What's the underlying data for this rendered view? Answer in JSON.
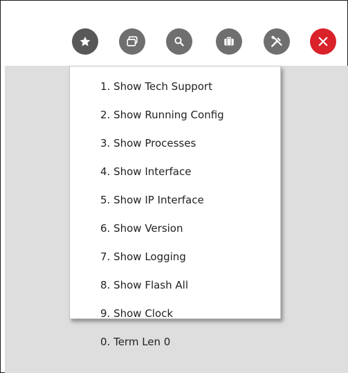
{
  "toolbar": {
    "buttons": [
      {
        "icon": "star-icon",
        "color": "#585858"
      },
      {
        "icon": "windows-icon",
        "color": "#6f6f6f"
      },
      {
        "icon": "search-icon",
        "color": "#6f6f6f"
      },
      {
        "icon": "briefcase-icon",
        "color": "#6f6f6f"
      },
      {
        "icon": "tools-icon",
        "color": "#6f6f6f"
      },
      {
        "icon": "close-icon",
        "color": "#d9222a"
      }
    ]
  },
  "menu": {
    "items": [
      {
        "label": "1. Show Tech Support"
      },
      {
        "label": "2. Show Running Config"
      },
      {
        "label": "3. Show Processes"
      },
      {
        "label": "4. Show Interface"
      },
      {
        "label": "5. Show IP Interface"
      },
      {
        "label": "6. Show Version"
      },
      {
        "label": "7. Show Logging"
      },
      {
        "label": "8. Show Flash All"
      },
      {
        "label": "9. Show Clock"
      },
      {
        "label": "0. Term Len 0"
      }
    ]
  }
}
